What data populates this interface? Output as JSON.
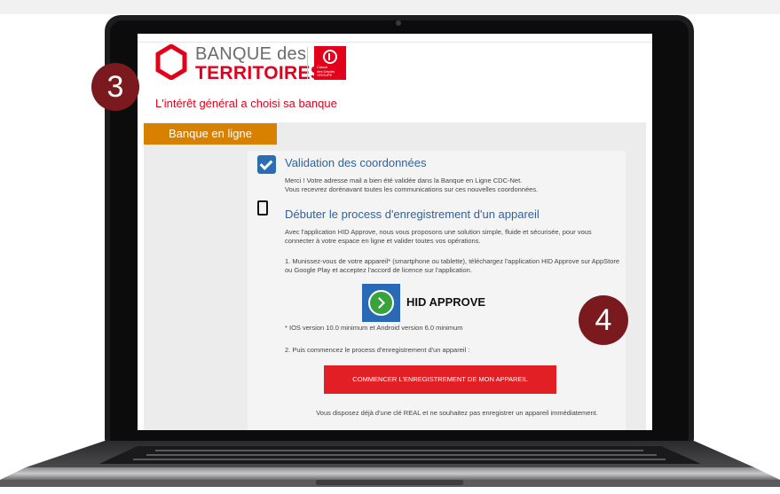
{
  "brand": {
    "line1": "BANQUE des",
    "line2": "TERRITOIRES",
    "cdc_text": "Caisse\ndes Dépôts\nGROUPE",
    "tagline": "L'intérêt général a choisi sa banque",
    "accent_color": "#e2001a"
  },
  "nav": {
    "tab_label": "Banque en ligne",
    "tab_color": "#d88000"
  },
  "validation": {
    "icon": "check-icon",
    "title": "Validation des coordonnées",
    "text": "Merci ! Votre adresse mail a bien été validée dans la Banque en Ligne CDC-Net.\nVous recevrez dorénavant toutes les communications sur ces nouvelles coordonnées."
  },
  "register": {
    "icon": "phone-icon",
    "title": "Débuter le process d'enregistrement d'un appareil",
    "intro": "Avec l'application HID Approve, nous vous proposons une solution simple, fluide et sécurisée, pour vous connecter à  votre espace en ligne et valider toutes vos opérations.",
    "step1": "1. Munissez-vous de votre appareil* (smartphone ou tablette), téléchargez l'application HID Approve sur AppStore ou Google Play et acceptez l'accord de licence sur l'application.",
    "app_name": "HID APPROVE",
    "note": "* IOS version 10.0 minimum et Android version 6.0 minimum",
    "step2": "2. Puis commencez le process d'enregistrement d'un appareil :",
    "button_label": "COMMENCER L'ENREGISTREMENT DE MON APPAREIL",
    "footer": "Vous disposez déjà d'une clé REAL et ne souhaitez pas enregistrer un appareil immédiatement."
  },
  "badges": {
    "step_a": "3",
    "step_b": "4",
    "color": "#7b1a1e"
  }
}
